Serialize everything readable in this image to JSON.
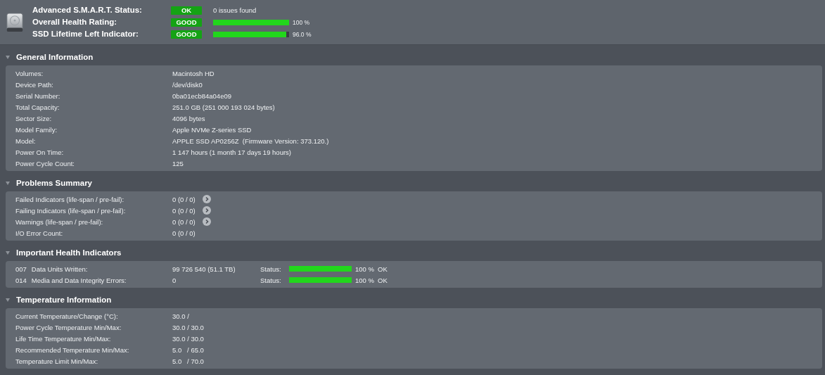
{
  "summary": [
    {
      "kind": "text",
      "label": "Advanced S.M.A.R.T. Status:",
      "badge": "OK",
      "detail": "0 issues found"
    },
    {
      "kind": "bar",
      "label": "Overall Health Rating:",
      "badge": "GOOD",
      "level": 1.0,
      "reading": "100 %"
    },
    {
      "kind": "bar",
      "label": "SSD Lifetime Left Indicator:",
      "badge": "GOOD",
      "level": 0.96,
      "reading": "96.0 %"
    }
  ],
  "sections": [
    {
      "kind": "info",
      "title": "General Information",
      "expanded": true,
      "rows": [
        {
          "label": "Volumes:",
          "value": "Macintosh HD"
        },
        {
          "label": "Device Path:",
          "value": "/dev/disk0"
        },
        {
          "label": "Serial Number:",
          "value": "0ba01ecb84a04e09"
        },
        {
          "label": "Total Capacity:",
          "value": "251.0 GB (251 000 193 024 bytes)"
        },
        {
          "label": "Sector Size:",
          "value": "4096 bytes"
        },
        {
          "label": "Model Family:",
          "value": "Apple NVMe Z-series SSD"
        },
        {
          "label": "Model:",
          "value": "APPLE SSD AP0256Z  (Firmware Version: 373.120.)"
        },
        {
          "label": "Power On Time:",
          "value": "1 147 hours (1 month 17 days 19 hours)"
        },
        {
          "label": "Power Cycle Count:",
          "value": "125"
        }
      ]
    },
    {
      "kind": "info",
      "title": "Problems Summary",
      "expanded": true,
      "rows": [
        {
          "label": "Failed Indicators (life-span / pre-fail):",
          "value": "0 (0 / 0)",
          "arrow": true
        },
        {
          "label": "Failing Indicators (life-span / pre-fail):",
          "value": "0 (0 / 0)",
          "arrow": true
        },
        {
          "label": "Warnings (life-span / pre-fail):",
          "value": "0 (0 / 0)",
          "arrow": true
        },
        {
          "label": "I/O Error Count:",
          "value": "0 (0 / 0)",
          "arrow": false
        }
      ]
    },
    {
      "kind": "health",
      "title": "Important Health Indicators",
      "expanded": true,
      "rows": [
        {
          "id": "007",
          "label": "Data Units Written:",
          "value": "99 726 540 (51.1 TB)",
          "status_label": "Status:",
          "level": 1.0,
          "reading": "100 %",
          "status": "OK"
        },
        {
          "id": "014",
          "label": "Media and Data Integrity Errors:",
          "value": "0",
          "status_label": "Status:",
          "level": 1.0,
          "reading": "100 %",
          "status": "OK"
        }
      ]
    },
    {
      "kind": "info",
      "title": "Temperature Information",
      "expanded": true,
      "rows": [
        {
          "label": "Current Temperature/Change (°C):",
          "value": "30.0 /"
        },
        {
          "label": "Power Cycle Temperature Min/Max:",
          "value": "30.0 / 30.0"
        },
        {
          "label": "Life Time Temperature Min/Max:",
          "value": "30.0 / 30.0"
        },
        {
          "label": "Recommended Temperature Min/Max:",
          "value": "5.0   / 65.0"
        },
        {
          "label": "Temperature Limit Min/Max:",
          "value": "5.0   / 70.0"
        }
      ]
    }
  ]
}
